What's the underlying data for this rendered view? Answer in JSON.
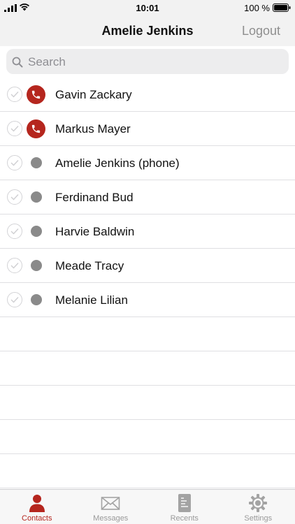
{
  "status_bar": {
    "time": "10:01",
    "battery": "100 %"
  },
  "header": {
    "title": "Amelie Jenkins",
    "logout_label": "Logout"
  },
  "search": {
    "placeholder": "Search",
    "value": ""
  },
  "contacts": [
    {
      "name": "Gavin Zackary",
      "status": "in-call"
    },
    {
      "name": "Markus Mayer",
      "status": "in-call"
    },
    {
      "name": "Amelie Jenkins (phone)",
      "status": "offline"
    },
    {
      "name": "Ferdinand Bud",
      "status": "offline"
    },
    {
      "name": "Harvie Baldwin",
      "status": "offline"
    },
    {
      "name": "Meade Tracy",
      "status": "offline"
    },
    {
      "name": "Melanie Lilian",
      "status": "offline"
    }
  ],
  "tabs": [
    {
      "label": "Contacts",
      "icon": "person-icon",
      "active": true
    },
    {
      "label": "Messages",
      "icon": "envelope-icon",
      "active": false
    },
    {
      "label": "Recents",
      "icon": "document-icon",
      "active": false
    },
    {
      "label": "Settings",
      "icon": "gear-icon",
      "active": false
    }
  ],
  "colors": {
    "accent": "#b5261e",
    "offline": "#8a8a8a",
    "bar_background": "#f2f2f2"
  }
}
